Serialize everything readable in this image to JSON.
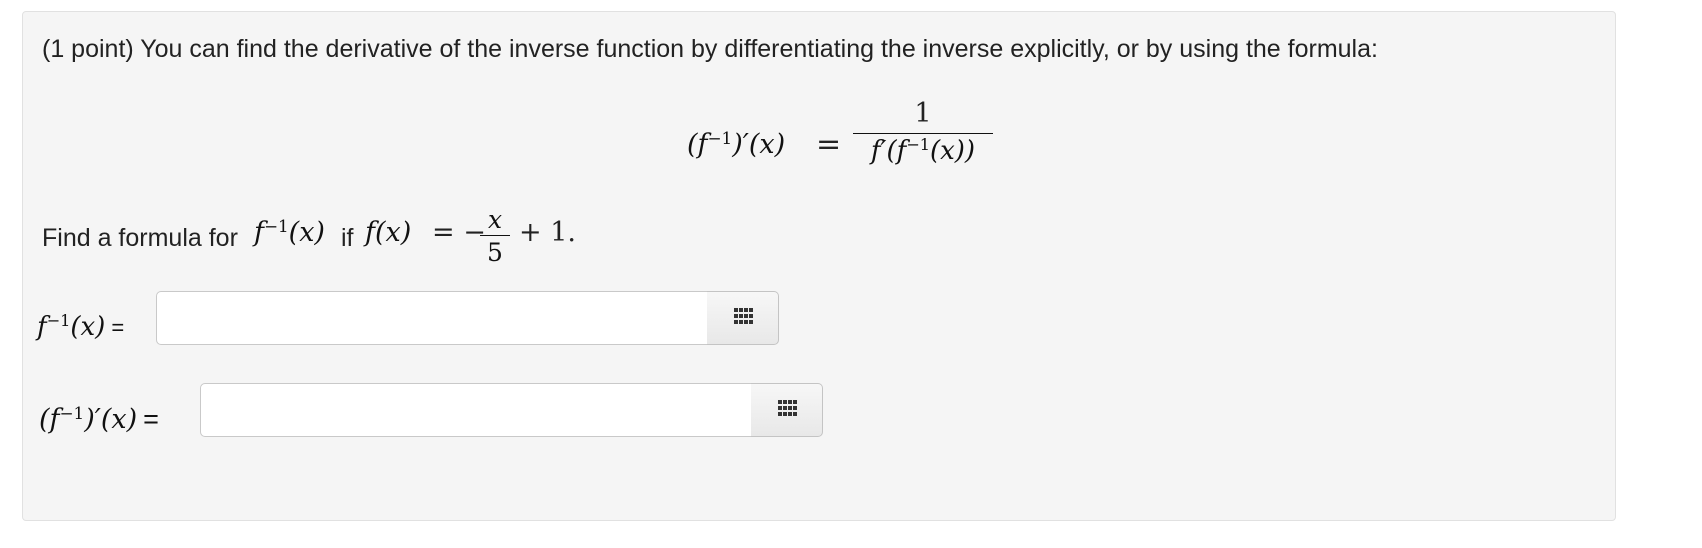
{
  "intro": "(1 point) You can find the derivative of the inverse function by differentiating the inverse explicitly, or by using the formula:",
  "display_formula": {
    "lhs_open": "(f",
    "lhs_sup": "−1",
    "lhs_close": ")′(x)",
    "equals": "=",
    "numerator": "1",
    "denominator_pre": "f′(f",
    "denominator_sup": "−1",
    "denominator_post": "(x))"
  },
  "question": {
    "text_before": "Find a formula for",
    "f_inv": "f",
    "f_inv_sup": "−1",
    "f_inv_arg": "(x)",
    "text_if": "if",
    "f_def": "f(x)",
    "equals_minus": "= −",
    "frac_num": "x",
    "frac_den": "5",
    "tail": "+ 1."
  },
  "answers": [
    {
      "label_pre": "f",
      "label_sup": "−1",
      "label_post": "(x)",
      "equals": "=",
      "value": ""
    },
    {
      "label_pre": "(f",
      "label_sup": "−1",
      "label_post": ")′(x)",
      "equals": "=",
      "value": ""
    }
  ],
  "icons": {
    "palette": "grid-icon"
  },
  "colors": {
    "panel_bg": "#f5f5f5",
    "panel_border": "#e1e1e1",
    "text": "#222222"
  }
}
